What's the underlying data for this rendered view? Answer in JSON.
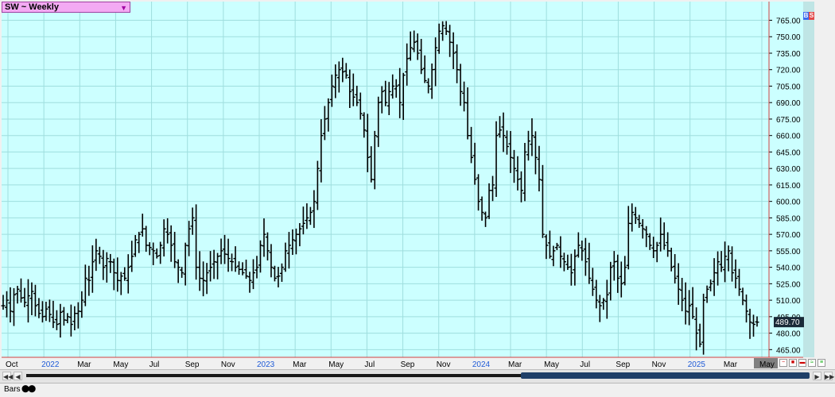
{
  "title": "SW ~ Weekly",
  "badges": {
    "b": "B",
    "s": "S"
  },
  "current_price": "489.70",
  "bars_label": "Bars",
  "colors": {
    "plot_bg": "#ccffff",
    "grid": "#9fdede",
    "bar": "#000000",
    "price_tag_bg": "#1a2a38",
    "price_tag_fg": "#ffffff",
    "axis_border": "#d04040",
    "x_label_year": "#1e5ad7"
  },
  "chart_data": {
    "type": "bar",
    "subtype": "ohlc",
    "title": "SW ~ Weekly",
    "y_ticks": [
      "765.00",
      "750.00",
      "735.00",
      "720.00",
      "705.00",
      "690.00",
      "675.00",
      "660.00",
      "645.00",
      "630.00",
      "615.00",
      "600.00",
      "585.00",
      "570.00",
      "555.00",
      "540.00",
      "525.00",
      "510.00",
      "495.00",
      "480.00",
      "465.00"
    ],
    "ylim": [
      458,
      782
    ],
    "x_ticks": [
      {
        "label": "Oct",
        "year": false
      },
      {
        "label": "2022",
        "year": true
      },
      {
        "label": "Mar",
        "year": false
      },
      {
        "label": "May",
        "year": false
      },
      {
        "label": "Jul",
        "year": false
      },
      {
        "label": "Sep",
        "year": false
      },
      {
        "label": "Nov",
        "year": false
      },
      {
        "label": "2023",
        "year": true
      },
      {
        "label": "Mar",
        "year": false
      },
      {
        "label": "May",
        "year": false
      },
      {
        "label": "Jul",
        "year": false
      },
      {
        "label": "Sep",
        "year": false
      },
      {
        "label": "Nov",
        "year": false
      },
      {
        "label": "2024",
        "year": true
      },
      {
        "label": "Mar",
        "year": false
      },
      {
        "label": "May",
        "year": false
      },
      {
        "label": "Jul",
        "year": false
      },
      {
        "label": "Sep",
        "year": false
      },
      {
        "label": "Nov",
        "year": false
      },
      {
        "label": "2025",
        "year": true
      },
      {
        "label": "Mar",
        "year": false
      },
      {
        "label": "May",
        "year": false
      }
    ],
    "grid": true,
    "weekly_closes": [
      505,
      510,
      500,
      515,
      520,
      512,
      508,
      514,
      518,
      505,
      498,
      495,
      502,
      497,
      490,
      488,
      499,
      492,
      495,
      488,
      498,
      500,
      510,
      530,
      528,
      545,
      555,
      550,
      540,
      548,
      545,
      535,
      528,
      532,
      530,
      540,
      550,
      565,
      570,
      575,
      560,
      558,
      555,
      550,
      560,
      575,
      570,
      560,
      545,
      540,
      535,
      560,
      575,
      585,
      540,
      530,
      528,
      535,
      540,
      545,
      550,
      555,
      552,
      548,
      545,
      540,
      538,
      535,
      532,
      528,
      535,
      540,
      560,
      570,
      555,
      540,
      530,
      532,
      540,
      555,
      560,
      565,
      570,
      575,
      580,
      585,
      590,
      600,
      630,
      660,
      675,
      690,
      705,
      715,
      720,
      718,
      715,
      700,
      695,
      690,
      680,
      665,
      640,
      620,
      660,
      690,
      700,
      690,
      700,
      705,
      705,
      690,
      715,
      730,
      740,
      745,
      735,
      720,
      710,
      705,
      720,
      740,
      755,
      760,
      755,
      745,
      735,
      720,
      700,
      690,
      660,
      640,
      620,
      600,
      590,
      585,
      610,
      615,
      660,
      665,
      660,
      650,
      640,
      630,
      620,
      610,
      645,
      655,
      660,
      640,
      620,
      570,
      560,
      550,
      555,
      560,
      550,
      545,
      540,
      535,
      550,
      560,
      555,
      545,
      530,
      520,
      510,
      505,
      510,
      515,
      540,
      545,
      530,
      525,
      540,
      580,
      590,
      585,
      580,
      575,
      570,
      560,
      555,
      560,
      570,
      560,
      555,
      540,
      530,
      520,
      510,
      500,
      505,
      495,
      480,
      470,
      510,
      520,
      525,
      535,
      545,
      540,
      550,
      555,
      535,
      530,
      520,
      510,
      500,
      490,
      488,
      490
    ]
  }
}
